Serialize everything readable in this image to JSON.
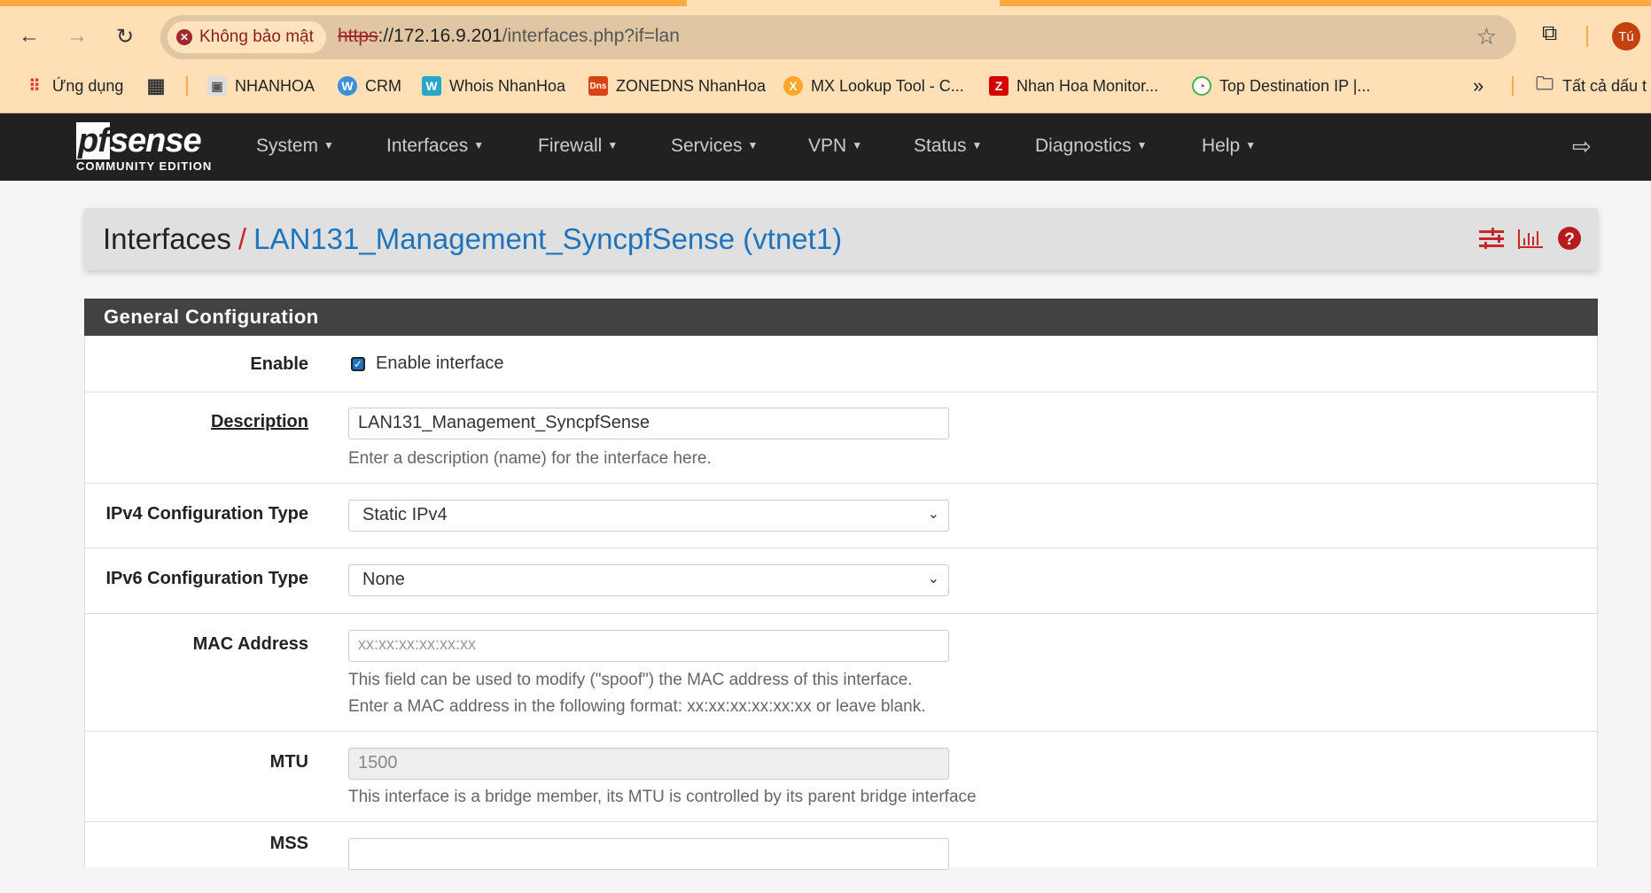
{
  "browser": {
    "security_label": "Không bảo mật",
    "url_scheme": "https",
    "url_host": "://172.16.9.201",
    "url_path": "/interfaces.php?if=lan",
    "avatar": "Tú",
    "bookmarks": [
      {
        "label": "Ứng dụng"
      },
      {
        "label": "NHANHOA"
      },
      {
        "label": "CRM"
      },
      {
        "label": "Whois NhanHoa"
      },
      {
        "label": "ZONEDNS NhanHoa"
      },
      {
        "label": "MX Lookup Tool - C..."
      },
      {
        "label": "Nhan Hoa Monitor..."
      },
      {
        "label": "Top Destination IP |..."
      }
    ],
    "more": "»",
    "all_bookmarks": "Tất cả dấu t"
  },
  "logo": {
    "brand": "pfsense",
    "edition": "COMMUNITY EDITION"
  },
  "nav": [
    "System",
    "Interfaces",
    "Firewall",
    "Services",
    "VPN",
    "Status",
    "Diagnostics",
    "Help"
  ],
  "breadcrumb": {
    "parent": "Interfaces",
    "separator": "/",
    "current": "LAN131_Management_SyncpfSense (vtnet1)"
  },
  "colors": {
    "accent": "#1e73be",
    "danger": "#c62828",
    "navbar": "#212121",
    "panel_head": "#424242"
  },
  "panel": {
    "title": "General Configuration",
    "enable": {
      "label": "Enable",
      "checkbox_label": "Enable interface",
      "checked": true
    },
    "description": {
      "label": "Description",
      "value": "LAN131_Management_SyncpfSense",
      "help": "Enter a description (name) for the interface here."
    },
    "ipv4": {
      "label": "IPv4 Configuration Type",
      "value": "Static IPv4"
    },
    "ipv6": {
      "label": "IPv6 Configuration Type",
      "value": "None"
    },
    "mac": {
      "label": "MAC Address",
      "placeholder": "xx:xx:xx:xx:xx:xx",
      "help1": "This field can be used to modify (\"spoof\") the MAC address of this interface.",
      "help2": "Enter a MAC address in the following format: xx:xx:xx:xx:xx:xx or leave blank."
    },
    "mtu": {
      "label": "MTU",
      "placeholder": "1500",
      "help": "This interface is a bridge member, its MTU is controlled by its parent bridge interface"
    },
    "mss": {
      "label": "MSS"
    }
  }
}
